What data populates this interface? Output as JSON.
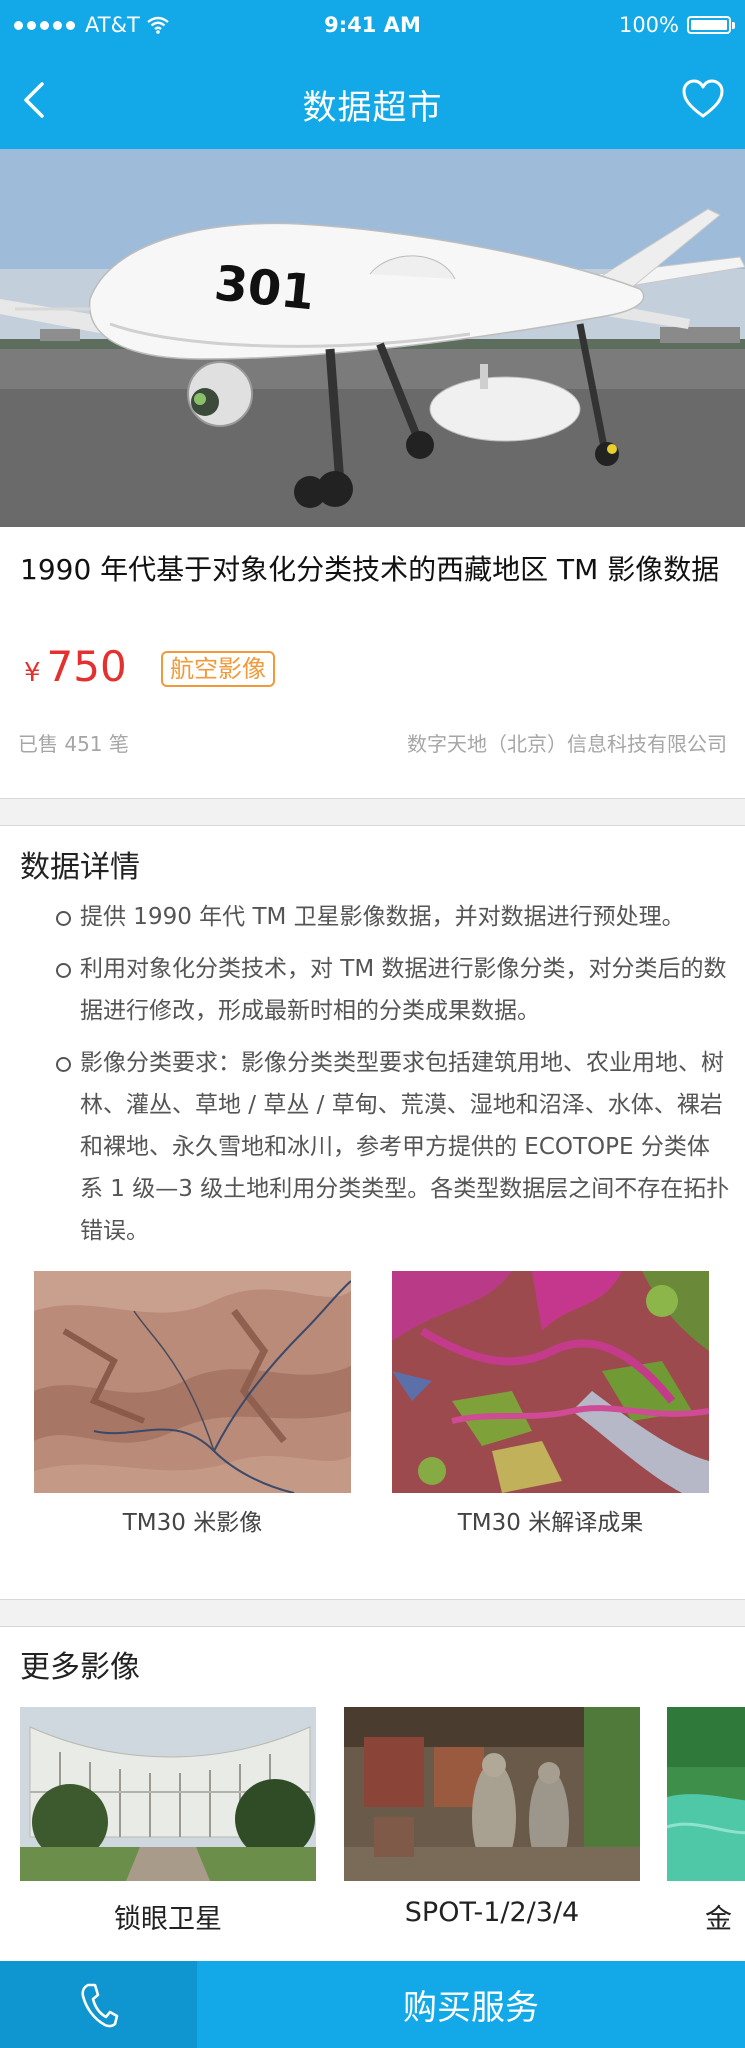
{
  "status_bar": {
    "carrier": "AT&T",
    "time": "9:41 AM",
    "battery": "100%"
  },
  "nav": {
    "title": "数据超市",
    "back_icon": "chevron-left-icon",
    "fav_icon": "heart-icon"
  },
  "hero": {
    "aircraft_number": "301"
  },
  "product": {
    "title": "1990 年代基于对象化分类技术的西藏地区 TM 影像数据",
    "currency": "¥",
    "price": "750",
    "tag": "航空影像",
    "sold": "已售 451 笔",
    "vendor": "数字天地（北京）信息科技有限公司"
  },
  "details": {
    "heading": "数据详情",
    "items": [
      "提供 1990 年代 TM 卫星影像数据，并对数据进行预处理。",
      "利用对象化分类技术，对 TM 数据进行影像分类，对分类后的数据进行修改，形成最新时相的分类成果数据。",
      "影像分类要求：影像分类类型要求包括建筑用地、农业用地、树林、灌丛、草地 / 草丛 / 草甸、荒漠、湿地和沼泽、水体、裸岩和裸地、永久雪地和冰川，参考甲方提供的 ECOTOPE 分类体系 1 级—3 级土地利用分类类型。各类型数据层之间不存在拓扑错误。"
    ],
    "images": [
      {
        "caption": "TM30 米影像"
      },
      {
        "caption": "TM30 米解译成果"
      }
    ]
  },
  "more": {
    "heading": "更多影像",
    "items": [
      {
        "caption": "锁眼卫星"
      },
      {
        "caption": "SPOT-1/2/3/4"
      },
      {
        "caption": "金"
      }
    ]
  },
  "bottom_bar": {
    "call_icon": "phone-icon",
    "buy_label": "购买服务"
  },
  "colors": {
    "primary": "#13a9e8",
    "price": "#e2312f",
    "tag": "#f19a3a"
  }
}
